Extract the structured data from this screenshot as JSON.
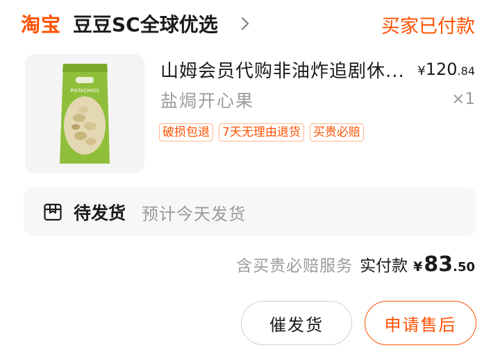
{
  "header": {
    "brand": "淘宝",
    "shop_name": "豆豆SC全球优选",
    "order_status": "买家已付款"
  },
  "product": {
    "title": "山姆会员代购非油炸追剧休...",
    "spec": "盐焗开心果",
    "price_currency": "¥",
    "price_int": "120",
    "price_dec": ".84",
    "quantity": "×1",
    "tags": [
      "破损包退",
      "7天无理由退货",
      "买贵必赔"
    ],
    "image_icon": "pistachio-bag-image",
    "image_label": "PISTACHIOS"
  },
  "shipping": {
    "status": "待发货",
    "note": "预计今天发货",
    "icon": "package-icon"
  },
  "payment": {
    "note": "含买贵必赔服务",
    "label": "实付款",
    "currency": "¥",
    "amount_int": "83",
    "amount_dec": ".50"
  },
  "actions": {
    "remind_label": "催发货",
    "aftersale_label": "申请售后"
  },
  "colors": {
    "accent": "#ff5000",
    "muted": "#9a9a9a",
    "panel": "#f7f7f7",
    "tag_border": "#ffb48a"
  }
}
